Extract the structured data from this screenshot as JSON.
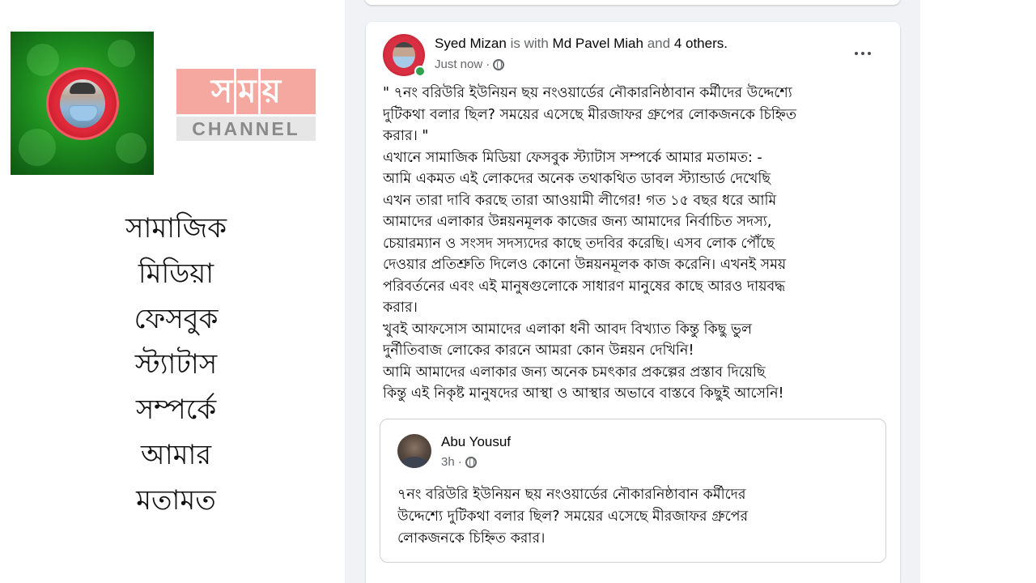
{
  "logo": {
    "bengali": [
      "স",
      "ম",
      "য়"
    ],
    "channel": "CHANNEL"
  },
  "caption_lines": [
    "সামাজিক",
    "মিডিয়া",
    "ফেসবুক",
    "স্ট্যাটাস",
    "সম্পর্কে",
    "আমার",
    "মতামত"
  ],
  "post": {
    "author": "Syed Mizan",
    "is_with": "is with",
    "tagged": "Md Pavel Miah",
    "and_text": "and",
    "others": "4 others.",
    "time": "Just now",
    "time_sep": "·",
    "body_lines": [
      "\" ৭নং বরিউরি ইউনিয়ন ছয় নংওয়ার্ডের নৌকারনিষ্ঠাবান কর্মীদের উদ্দেশ্যে",
      "দুটিকথা বলার ছিল? সময়ের এসেছে মীরজাফর গ্রুপের লোকজনকে চিহ্নিত",
      "করার। \"",
      "এখানে সামাজিক মিডিয়া ফেসবুক স্ট্যাটাস সম্পর্কে আমার মতামত: -",
      "আমি একমত এই লোকদের অনেক তথাকথিত ডাবল স্ট্যান্ডার্ড দেখেছি",
      "এখন তারা দাবি করছে তারা আওয়ামী লীগের! গত ১৫ বছর ধরে আমি",
      "আমাদের এলাকার উন্নয়নমূলক কাজের জন্য আমাদের নির্বাচিত সদস্য,",
      "চেয়ারম্যান ও সংসদ সদস্যদের কাছে তদবির করেছি। এসব লোক পৌঁছে",
      "দেওয়ার প্রতিশ্রুতি দিলেও কোনো উন্নয়নমূলক কাজ করেনি। এখনই সময়",
      "পরিবর্তনের এবং এই মানুষগুলোকে সাধারণ মানুষের কাছে আরও দায়বদ্ধ",
      "করার।",
      "খুবই আফসোস আমাদের এলাকা ধনী আবদ বিখ্যাত কিন্তু কিছু ভুল",
      "দুর্নীতিবাজ লোকের কারনে আমরা কোন উন্নয়ন দেখিনি!",
      "আমি আমাদের এলাকার জন্য অনেক চমৎকার প্রকল্পের প্রস্তাব দিয়েছি",
      "কিন্তু এই নিকৃষ্ট মানুষদের আস্থা ও আস্থার অভাবে বাস্তবে কিছুই আসেনি!"
    ]
  },
  "shared": {
    "author": "Abu Yousuf",
    "time": "3h",
    "time_sep": "·",
    "body_lines": [
      "৭নং বরিউরি ইউনিয়ন ছয় নংওয়ার্ডের নৌকারনিষ্ঠাবান  কর্মীদের",
      "উদ্দেশ্যে দুটিকথা  বলার ছিল? সময়ের এসেছে মীরজাফর গ্রুপের",
      "লোকজনকে চিহ্নিত করার।"
    ]
  }
}
